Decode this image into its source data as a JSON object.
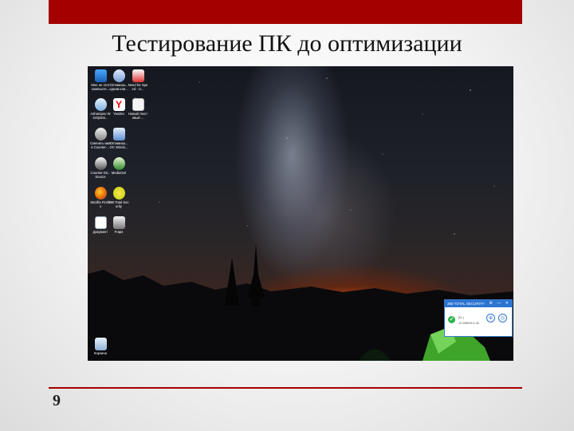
{
  "slide": {
    "title": "Тестирование ПК до оптимизации",
    "page_number": "9",
    "accent_color": "#a50000"
  },
  "desktop": {
    "icons": [
      {
        "label": "Мне не этот компьюте...",
        "icon": "computer-icon"
      },
      {
        "label": "Оптимиза... одним кли...",
        "icon": "optimizer-icon"
      },
      {
        "label": "Need for Speed - U...",
        "icon": "game-icon"
      },
      {
        "label": "Ashampoo WinOptimi...",
        "icon": "ashampoo-icon"
      },
      {
        "label": "Yandex",
        "icon": "yandex-icon"
      },
      {
        "label": "Новый текстовый ...",
        "icon": "text-file-icon"
      },
      {
        "label": "Сменить имя в Counter-...",
        "icon": "counter-strike-icon"
      },
      {
        "label": "Оптимиза... OC Windo...",
        "icon": "optimizer-icon"
      },
      {
        "label": "Counter-Str... Source",
        "icon": "counter-strike-icon"
      },
      {
        "label": "MediaGet",
        "icon": "mediaget-icon"
      },
      {
        "label": "Mozilla Firefox",
        "icon": "firefox-icon"
      },
      {
        "label": "360 Total Security",
        "icon": "360-security-icon"
      },
      {
        "label": "Документ",
        "icon": "document-icon"
      },
      {
        "label": "Fraps",
        "icon": "fraps-icon"
      },
      {
        "label": "Корзина",
        "icon": "recycle-bin-icon"
      }
    ],
    "antivirus_widget": {
      "title": "360 TOTAL SECURITY",
      "window_buttons": "⚙ — ✕",
      "line1": "ID: |",
      "line2": "12.5MB/5.6.40",
      "shield_glyph": "⊕",
      "settings_glyph": "◎"
    }
  }
}
